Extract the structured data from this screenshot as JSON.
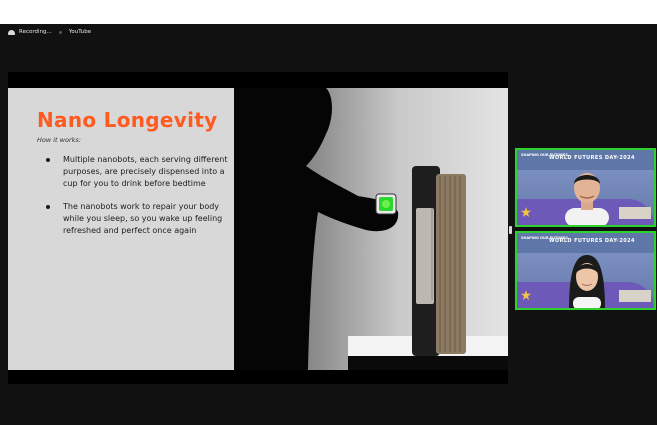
{
  "recording": {
    "label": "Recording...",
    "tab_label": "YouTube"
  },
  "slide": {
    "title": "Nano Longevity",
    "subtitle": "How it works:",
    "bullets": [
      "Multiple nanobots, each serving different purposes, are precisely dispensed into a cup for you to drink before bedtime",
      "The nanobots work to repair your body while you sleep, so you wake up feeling refreshed and perfect once again"
    ]
  },
  "participants": [
    {
      "banner_small": "SHAPING OUR FUTURES",
      "banner_title": "WORLD FUTURES DAY 2024"
    },
    {
      "banner_small": "SHAPING OUR FUTURES",
      "banner_title": "WORLD FUTURES DAY 2024"
    }
  ],
  "colors": {
    "accent": "#ff5a1f",
    "speaker_border": "#2ed12e"
  }
}
